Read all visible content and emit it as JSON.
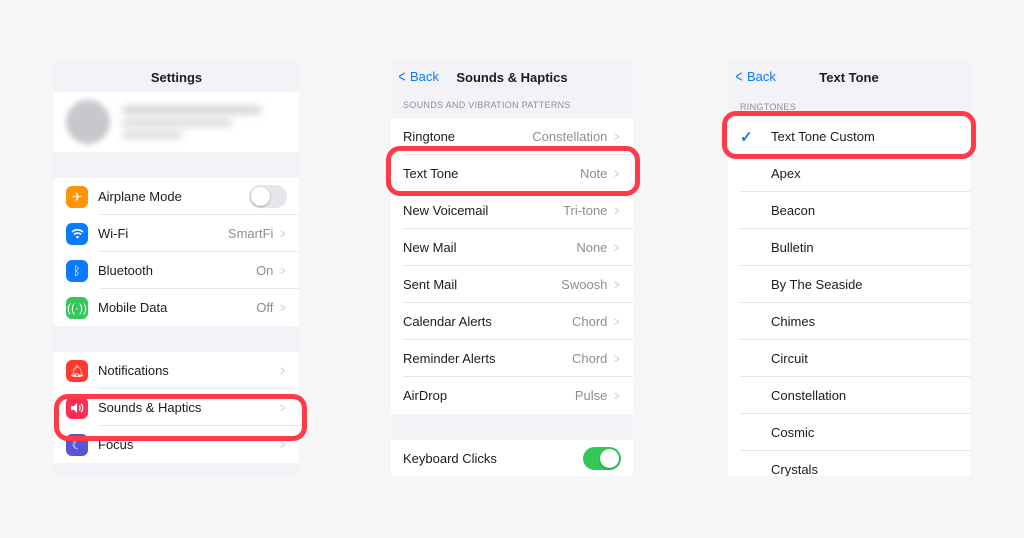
{
  "panel1": {
    "title": "Settings",
    "group1": [
      {
        "label": "Airplane Mode",
        "icon": "airplane-icon",
        "color": "#ff9500",
        "toggle": "off"
      },
      {
        "label": "Wi-Fi",
        "icon": "wifi-icon",
        "color": "#0a7aff",
        "value": "SmartFi"
      },
      {
        "label": "Bluetooth",
        "icon": "bluetooth-icon",
        "color": "#0a7aff",
        "value": "On"
      },
      {
        "label": "Mobile Data",
        "icon": "antenna-icon",
        "color": "#34c759",
        "value": "Off"
      }
    ],
    "group2": [
      {
        "label": "Notifications",
        "icon": "bell-icon",
        "color": "#ff3b30"
      },
      {
        "label": "Sounds & Haptics",
        "icon": "speaker-icon",
        "color": "#ff2d55"
      },
      {
        "label": "Focus",
        "icon": "moon-icon",
        "color": "#5856d6"
      }
    ]
  },
  "panel2": {
    "back": "Back",
    "title": "Sounds & Haptics",
    "section_header": "SOUNDS AND VIBRATION PATTERNS",
    "rows": [
      {
        "label": "Ringtone",
        "value": "Constellation"
      },
      {
        "label": "Text Tone",
        "value": "Note"
      },
      {
        "label": "New Voicemail",
        "value": "Tri-tone"
      },
      {
        "label": "New Mail",
        "value": "None"
      },
      {
        "label": "Sent Mail",
        "value": "Swoosh"
      },
      {
        "label": "Calendar Alerts",
        "value": "Chord"
      },
      {
        "label": "Reminder Alerts",
        "value": "Chord"
      },
      {
        "label": "AirDrop",
        "value": "Pulse"
      }
    ],
    "keyboard_clicks": "Keyboard Clicks",
    "keyboard_clicks_state": "on"
  },
  "panel3": {
    "back": "Back",
    "title": "Text Tone",
    "section_header": "RINGTONES",
    "selected": "Text Tone Custom",
    "tones": [
      "Apex",
      "Beacon",
      "Bulletin",
      "By The Seaside",
      "Chimes",
      "Circuit",
      "Constellation",
      "Cosmic",
      "Crystals"
    ]
  },
  "colors": {
    "accent": "#0a7aff",
    "highlight": "#ff3b4a",
    "toggle_on": "#34c759"
  }
}
